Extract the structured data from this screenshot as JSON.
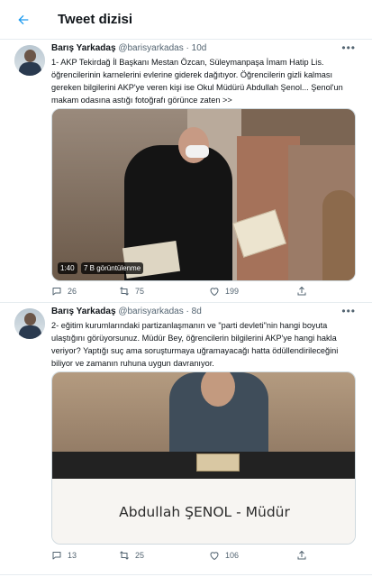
{
  "header": {
    "title": "Tweet dizisi"
  },
  "tweets": [
    {
      "name": "Barış Yarkadaş",
      "handle": "@barisyarkadas",
      "time": "10d",
      "text": "1- AKP Tekirdağ İl Başkanı Mestan Özcan, Süleymanpaşa İmam Hatip Lis. öğrencilerinin karnelerini evlerine giderek dağıtıyor. Öğrencilerin gizli kalması gereken bilgilerini AKP'ye veren kişi ise Okul Müdürü Abdullah Şenol... Şenol'un makam odasına astığı fotoğrafı görünce zaten >>",
      "media": {
        "duration": "1:40",
        "views": "7 B görüntülenme"
      },
      "stats": {
        "replies": "26",
        "retweets": "75",
        "likes": "199"
      }
    },
    {
      "name": "Barış Yarkadaş",
      "handle": "@barisyarkadas",
      "time": "8d",
      "text": "2- eğitim kurumlarındaki partizanlaşmanın ve \"parti devleti\"nin hangi boyuta ulaştığını görüyorsunuz. Müdür Bey, öğrencilerin bilgilerini AKP'ye hangi hakla veriyor? Yaptığı suç ama soruşturmaya uğramayacağı hatta ödüllendirileceğini biliyor ve zamanın ruhuna uygun davranıyor.",
      "media": {
        "caption": "Abdullah ŞENOL - Müdür"
      },
      "stats": {
        "replies": "13",
        "retweets": "25",
        "likes": "106"
      }
    }
  ],
  "colors": {
    "accent": "#1d9bf0",
    "secondary_text": "#536471",
    "border": "#e6ecf0"
  }
}
